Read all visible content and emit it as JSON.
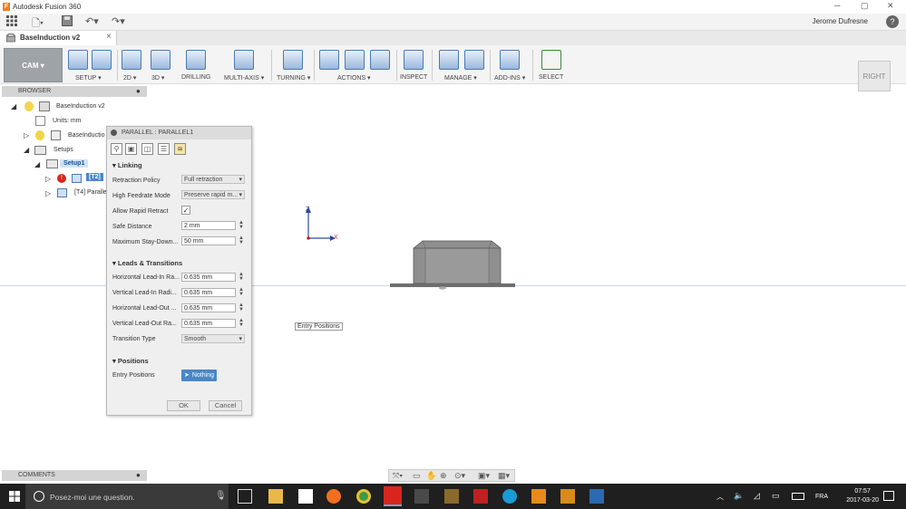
{
  "app": {
    "title": "Autodesk Fusion 360",
    "user": "Jerome Dufresne",
    "help": "?"
  },
  "document": {
    "tab_name": "BaseInduction v2",
    "close": "×"
  },
  "ribbon": {
    "workspace": "CAM ▾",
    "groups": [
      "SETUP ▾",
      "2D ▾",
      "3D ▾",
      "DRILLING",
      "MULTI-AXIS ▾",
      "TURNING ▾",
      "ACTIONS ▾",
      "INSPECT",
      "MANAGE ▾",
      "ADD-INS ▾",
      "SELECT"
    ]
  },
  "viewcube": {
    "face": "RIGHT"
  },
  "browser": {
    "title": "BROWSER",
    "items": [
      {
        "label": "BaseInduction v2"
      },
      {
        "label": "Units: mm"
      },
      {
        "label": "BaseInductio"
      },
      {
        "label": "Setups"
      },
      {
        "label": "Setup1"
      },
      {
        "label": "[T2]"
      },
      {
        "label": "[T4] Paralle"
      }
    ]
  },
  "dialog": {
    "title": "PARALLEL : PARALLEL1",
    "linking": {
      "header": "Linking",
      "retraction_label": "Retraction Policy",
      "retraction_value": "Full retraction",
      "feedrate_label": "High Feedrate Mode",
      "feedrate_value": "Preserve rapid m...",
      "rapid_label": "Allow Rapid Retract",
      "rapid_checked": "✓",
      "safe_label": "Safe Distance",
      "safe_value": "2 mm",
      "stay_label": "Maximum Stay-Down...",
      "stay_value": "50 mm"
    },
    "leads": {
      "header": "Leads & Transitions",
      "h_in_label": "Horizontal Lead-In Ra...",
      "h_in_value": "0.635 mm",
      "v_in_label": "Vertical Lead-In Radi...",
      "v_in_value": "0.635 mm",
      "h_out_label": "Horizontal Lead-Out ...",
      "h_out_value": "0.635 mm",
      "v_out_label": "Vertical Lead-Out Ra...",
      "v_out_value": "0.635 mm",
      "transition_label": "Transition Type",
      "transition_value": "Smooth"
    },
    "positions": {
      "header": "Positions",
      "entry_label": "Entry Positions",
      "entry_value": "Nothing"
    },
    "ok": "OK",
    "cancel": "Cancel"
  },
  "canvas": {
    "tooltip": "Entry Positions",
    "axis_z": "Z",
    "axis_x": "X"
  },
  "comments": {
    "title": "COMMENTS"
  },
  "taskbar": {
    "search_placeholder": "Posez-moi une question.",
    "lang": "FRA",
    "time": "07:57",
    "date": "2017-03-20"
  },
  "colors": {
    "accent": "#4a87c7",
    "taskbar": "#1f1f1f",
    "part": "#8f8f8f"
  }
}
